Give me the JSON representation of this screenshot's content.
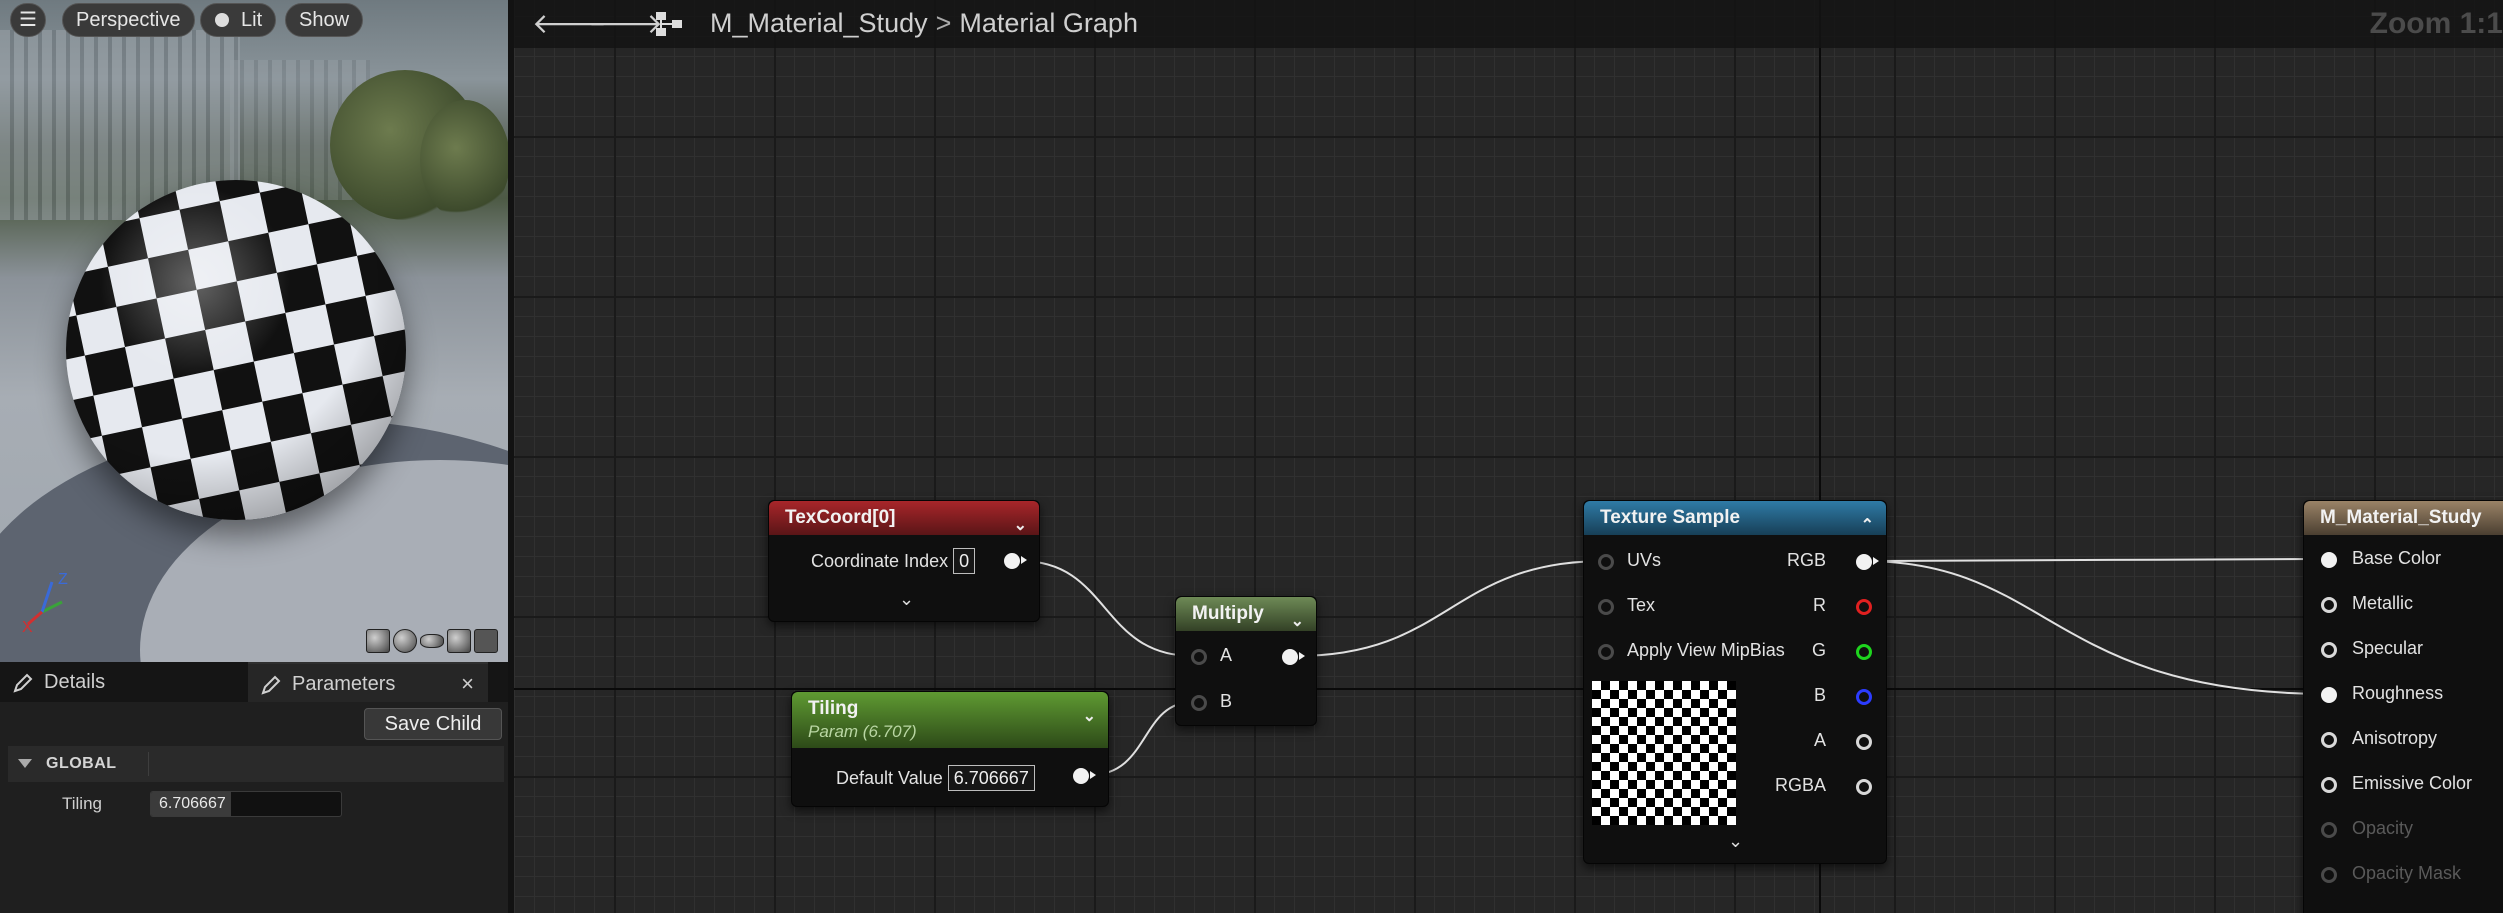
{
  "viewport": {
    "menu_icon": "hamburger-icon",
    "perspective_label": "Perspective",
    "lit_label": "Lit",
    "show_label": "Show",
    "axis_labels": {
      "x": "X",
      "z": "Z"
    },
    "preview_shapes": [
      "cylinder-icon",
      "sphere-icon",
      "plane-icon",
      "cube-icon",
      "custom-mesh-icon"
    ]
  },
  "panel": {
    "tabs": [
      {
        "label": "Details",
        "icon": "pencil-icon"
      },
      {
        "label": "Parameters",
        "icon": "pencil-icon"
      }
    ],
    "close_glyph": "×",
    "save_child_label": "Save Child",
    "group_label": "GLOBAL",
    "parameters": [
      {
        "name": "Tiling",
        "value": "6.706667",
        "slider_fraction": 0.42
      }
    ]
  },
  "graph": {
    "breadcrumb": {
      "asset": "M_Material_Study",
      "graph": "Material Graph"
    },
    "zoom_label": "Zoom 1:1",
    "nodes": {
      "texcoord": {
        "title": "TexCoord[0]",
        "field_label": "Coordinate Index",
        "field_value": "0"
      },
      "multiply": {
        "title": "Multiply",
        "pins": [
          "A",
          "B"
        ]
      },
      "tiling": {
        "title": "Tiling",
        "subtitle": "Param (6.707)",
        "field_label": "Default Value",
        "field_value": "6.706667"
      },
      "texture_sample": {
        "title": "Texture Sample",
        "inputs": [
          "UVs",
          "Tex",
          "Apply View MipBias"
        ],
        "outputs": [
          "RGB",
          "R",
          "G",
          "B",
          "A",
          "RGBA"
        ]
      },
      "output": {
        "title": "M_Material_Study",
        "inputs": [
          {
            "label": "Base Color",
            "state": "connected"
          },
          {
            "label": "Metallic",
            "state": "active"
          },
          {
            "label": "Specular",
            "state": "active"
          },
          {
            "label": "Roughness",
            "state": "connected"
          },
          {
            "label": "Anisotropy",
            "state": "active"
          },
          {
            "label": "Emissive Color",
            "state": "active"
          },
          {
            "label": "Opacity",
            "state": "disabled"
          },
          {
            "label": "Opacity Mask",
            "state": "disabled"
          }
        ]
      }
    },
    "colors": {
      "texcoord_header": "#a8262a",
      "multiply_header": "#6e8a56",
      "tiling_header": "#5f9a32",
      "texture_header": "#2f7ba6",
      "output_header": "#9a8367",
      "pin_r": "#e02020",
      "pin_g": "#1ed41e",
      "pin_b": "#2c3cff"
    }
  }
}
